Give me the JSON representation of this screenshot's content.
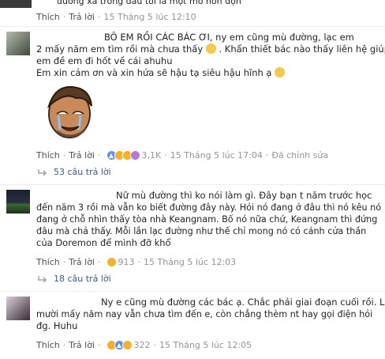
{
  "top": {
    "text": "đường xá trong đầu tôi là một mớ hỗn độn",
    "like": "Thích",
    "reply": "Trả lời",
    "time": "15 Tháng 5 lúc 12:10"
  },
  "c1": {
    "name": "BÔ",
    "lines": [
      "BÔ       EM RỒI CÁC BÁC ƠI, ny em cũng mù đường, lạc em",
      "2 mấy năm em tìm rồi mà chưa thấy",
      ". Khẩn thiết bác nào thấy liên hệ giúp",
      "em đề em đi hốt về cái ahuhu",
      "Em xin cảm ơn và xin hứa sẽ hậu tạ siêu hậu hĩnh ạ"
    ],
    "like": "Thích",
    "reply": "Trả lời",
    "count": "3,1K",
    "time": "15 Tháng 5 lúc 17:04",
    "edited": "Đã chỉnh sửa",
    "replies": "53 câu trả lời"
  },
  "c2": {
    "lines": [
      "Nữ mù đường thì ko nói làm gì. Đây bạn t năm trước học",
      "đến năm 3 rồi mà vẫn ko biết đường đây này. Hỏi nó đang ở đâu thì nó kêu nó",
      "đang ở chỗ nhìn thấy tòa nhà Keangnam. Bố nó nữa chứ, Keangnam thì đứng",
      "đâu mà chả thấy. Mỗi lần lạc đường như thế chỉ mong nó có cánh cửa thần",
      "của Doremon để mình đỡ khổ"
    ],
    "like": "Thích",
    "reply": "Trả lời",
    "count": "913",
    "time": "15 Tháng 5 lúc 12:03",
    "replies": "18 câu trả lời"
  },
  "c3": {
    "lines": [
      "Ny e cũng mù đường các bác ạ. Chắc phải giai đoạn cuối rồi. Lạc",
      "mười mấy năm nay vẫn chưa tìm đến e, còn chẳng thèm nt hay gọi điện hỏi",
      "đg. Huhu"
    ],
    "like": "Thích",
    "reply": "Trả lời",
    "count": "322",
    "time": "15 Tháng 5 lúc 12:05"
  }
}
